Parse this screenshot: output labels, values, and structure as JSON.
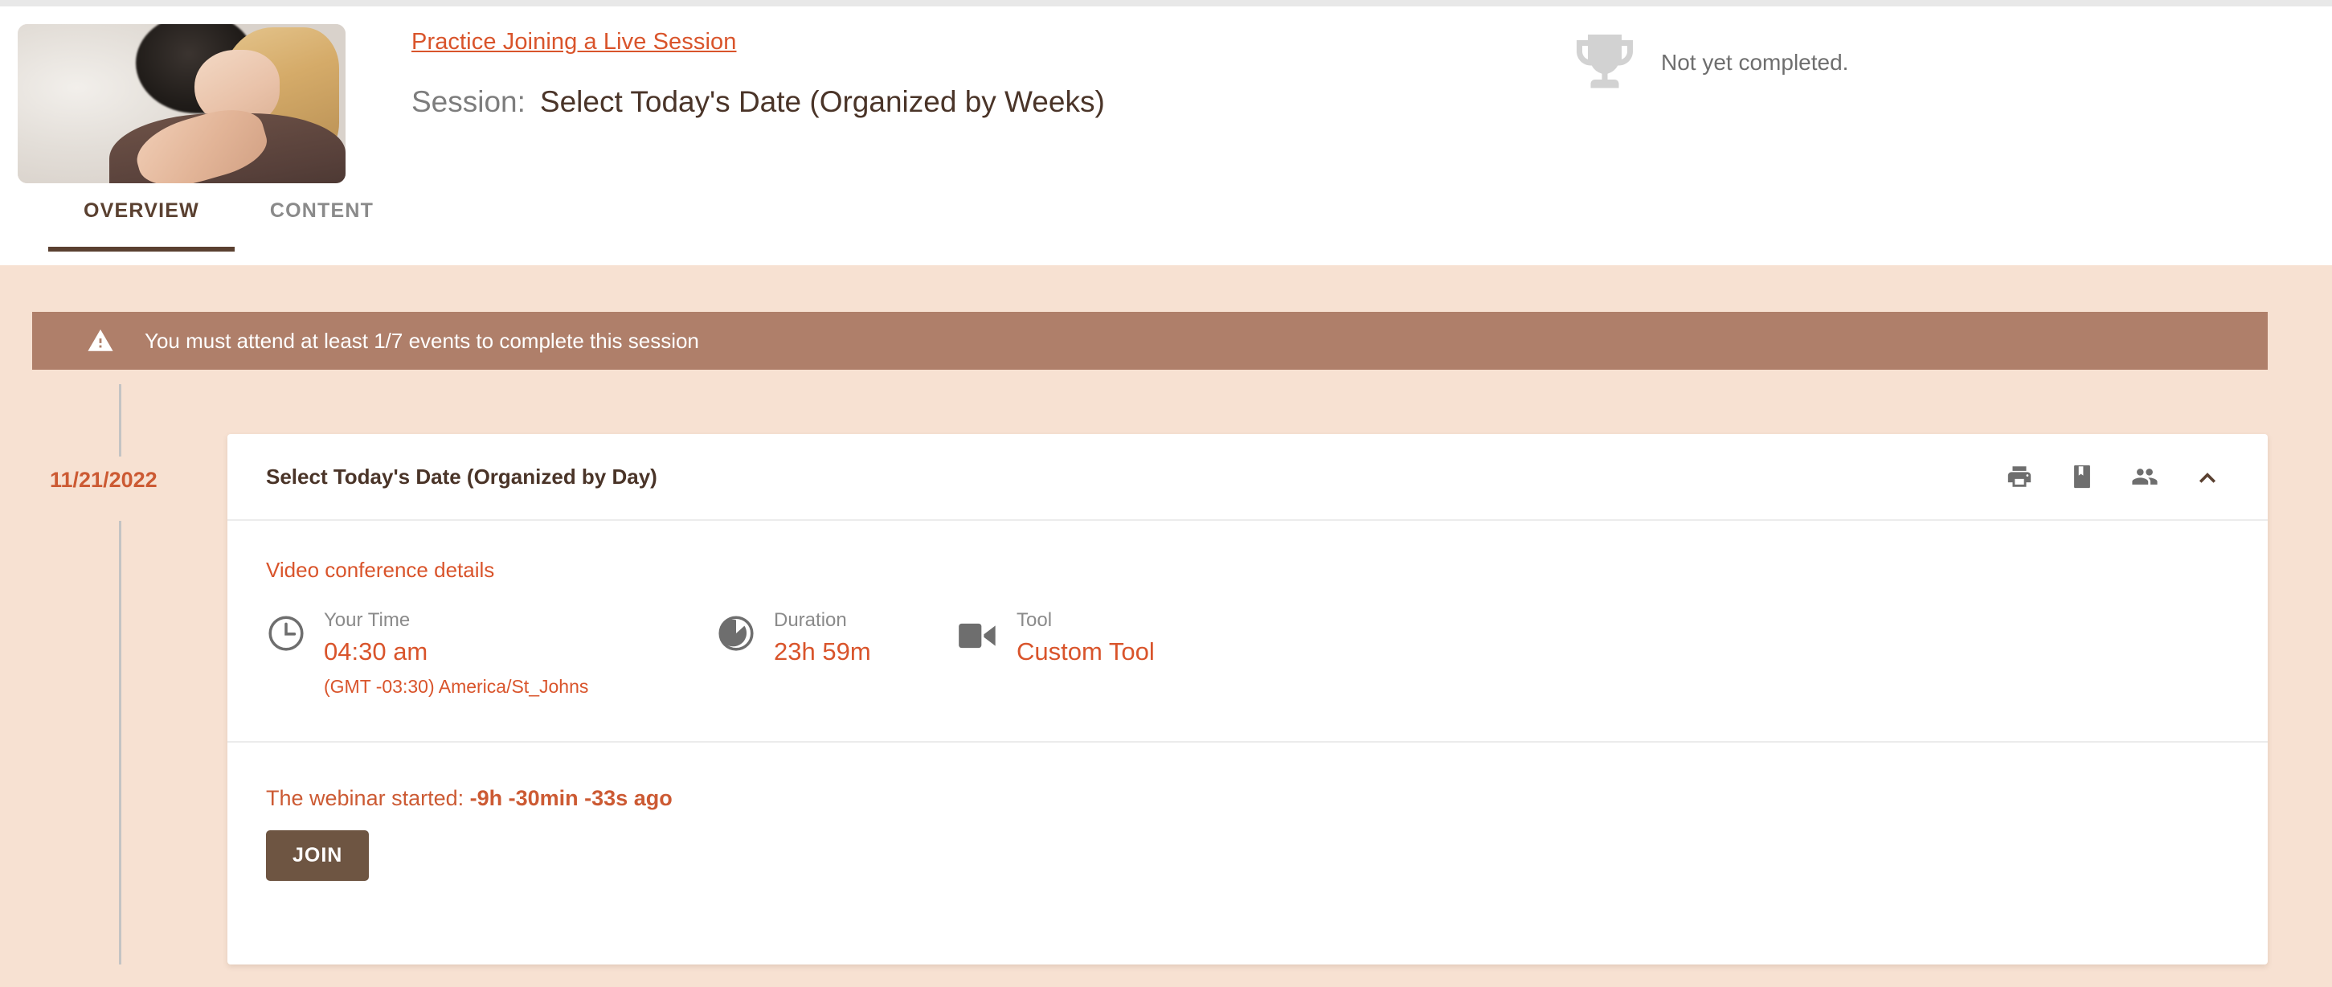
{
  "header": {
    "course_link": "Practice Joining a Live Session",
    "session_label": "Session:",
    "session_title": "Select Today's Date (Organized by Weeks)",
    "thumbnail_alt": "course-thumbnail",
    "completion_status": "Not yet completed.",
    "trophy_icon": "trophy-icon",
    "accent_color": "#d9542b",
    "title_color": "#4a3428"
  },
  "tabs": [
    {
      "label": "OVERVIEW",
      "active": true
    },
    {
      "label": "CONTENT",
      "active": false
    }
  ],
  "alert": {
    "icon": "warning-triangle-icon",
    "text": "You must attend at least 1/7 events to complete this session",
    "background_color": "#af7f6a",
    "text_color": "#ffffff"
  },
  "timeline": {
    "date": "11/21/2022",
    "date_color": "#cc5a33",
    "line_color": "#c4c4c4"
  },
  "card": {
    "title": "Select Today's Date (Organized by Day)",
    "actions": [
      {
        "name": "print-icon",
        "label": "Print"
      },
      {
        "name": "bookmark-icon",
        "label": "Bookmark"
      },
      {
        "name": "people-icon",
        "label": "Attendees"
      },
      {
        "name": "chevron-up-icon",
        "label": "Collapse"
      }
    ],
    "video_conference": {
      "heading": "Video conference details",
      "items": [
        {
          "icon": "clock-icon",
          "label": "Your Time",
          "value": "04:30 am",
          "sub": "(GMT -03:30) America/St_Johns"
        },
        {
          "icon": "timer-icon",
          "label": "Duration",
          "value": "23h 59m",
          "sub": ""
        },
        {
          "icon": "video-camera-icon",
          "label": "Tool",
          "value": "Custom Tool",
          "sub": ""
        }
      ]
    },
    "footer": {
      "status_prefix": "The webinar started:",
      "status_value": "-9h -30min -33s ago",
      "join_label": "JOIN",
      "join_color": "#6e5542"
    }
  },
  "colors": {
    "page_background": "#f7e1d2",
    "card_background": "#ffffff",
    "divider": "#ececec"
  }
}
